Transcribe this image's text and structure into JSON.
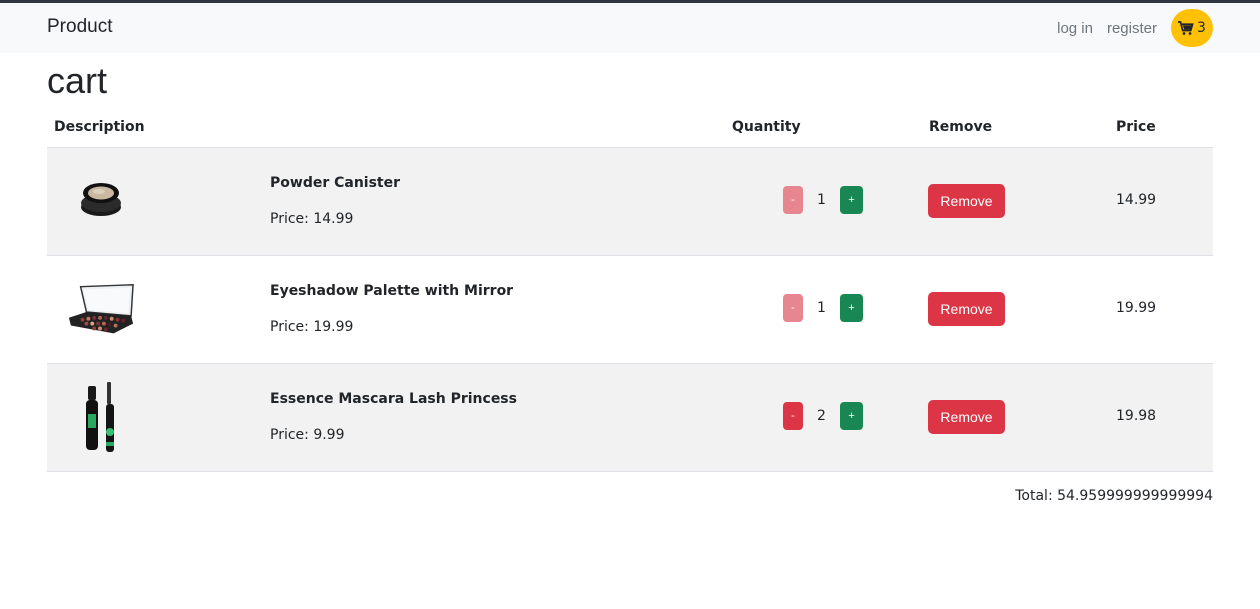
{
  "navbar": {
    "brand": "Product",
    "login": "log in",
    "register": "register",
    "cart_count": "3",
    "cart_icon": "cart-icon"
  },
  "page": {
    "title": "cart"
  },
  "table": {
    "headers": {
      "description": "Description",
      "quantity": "Quantity",
      "remove": "Remove",
      "price": "Price"
    },
    "rows": [
      {
        "name": "Powder Canister",
        "price_label": "Price: 14.99",
        "quantity": "1",
        "minus": "-",
        "plus": "+",
        "remove": "Remove",
        "line_total": "14.99",
        "thumb": "powder-compact-image"
      },
      {
        "name": "Eyeshadow Palette with Mirror",
        "price_label": "Price: 19.99",
        "quantity": "1",
        "minus": "-",
        "plus": "+",
        "remove": "Remove",
        "line_total": "19.99",
        "thumb": "eyeshadow-palette-image"
      },
      {
        "name": "Essence Mascara Lash Princess",
        "price_label": "Price: 9.99",
        "quantity": "2",
        "minus": "-",
        "plus": "+",
        "remove": "Remove",
        "line_total": "19.98",
        "thumb": "mascara-image"
      }
    ]
  },
  "total": "Total: 54.959999999999994",
  "colors": {
    "danger": "#dc3545",
    "success": "#198754",
    "warning": "#ffc107",
    "navbar_bg": "#f8f9fa"
  }
}
